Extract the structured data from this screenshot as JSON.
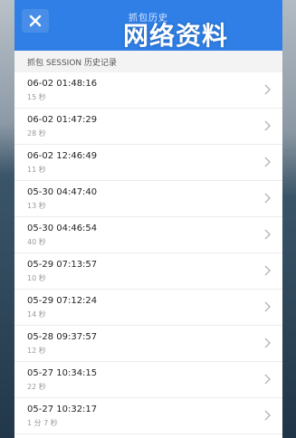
{
  "titlebar": {
    "close_icon": "close-icon",
    "title": "抓包历史",
    "watermark": "网络资料"
  },
  "section": {
    "header": "抓包 SESSION 历史记录"
  },
  "sessions": [
    {
      "time": "06-02 01:48:16",
      "duration": "15 秒"
    },
    {
      "time": "06-02 01:47:29",
      "duration": "28 秒"
    },
    {
      "time": "06-02 12:46:49",
      "duration": "11 秒"
    },
    {
      "time": "05-30 04:47:40",
      "duration": "13 秒"
    },
    {
      "time": "05-30 04:46:54",
      "duration": "40 秒"
    },
    {
      "time": "05-29 07:13:57",
      "duration": "10 秒"
    },
    {
      "time": "05-29 07:12:24",
      "duration": "14 秒"
    },
    {
      "time": "05-28 09:37:57",
      "duration": "12 秒"
    },
    {
      "time": "05-27 10:34:15",
      "duration": "22 秒"
    },
    {
      "time": "05-27 10:32:17",
      "duration": "1 分 7 秒"
    }
  ],
  "icons": {
    "row_chevron": "chevron-right-icon"
  },
  "colors": {
    "titlebar": "#2f7fe6",
    "row_text": "#222222",
    "row_sub": "#999999"
  }
}
